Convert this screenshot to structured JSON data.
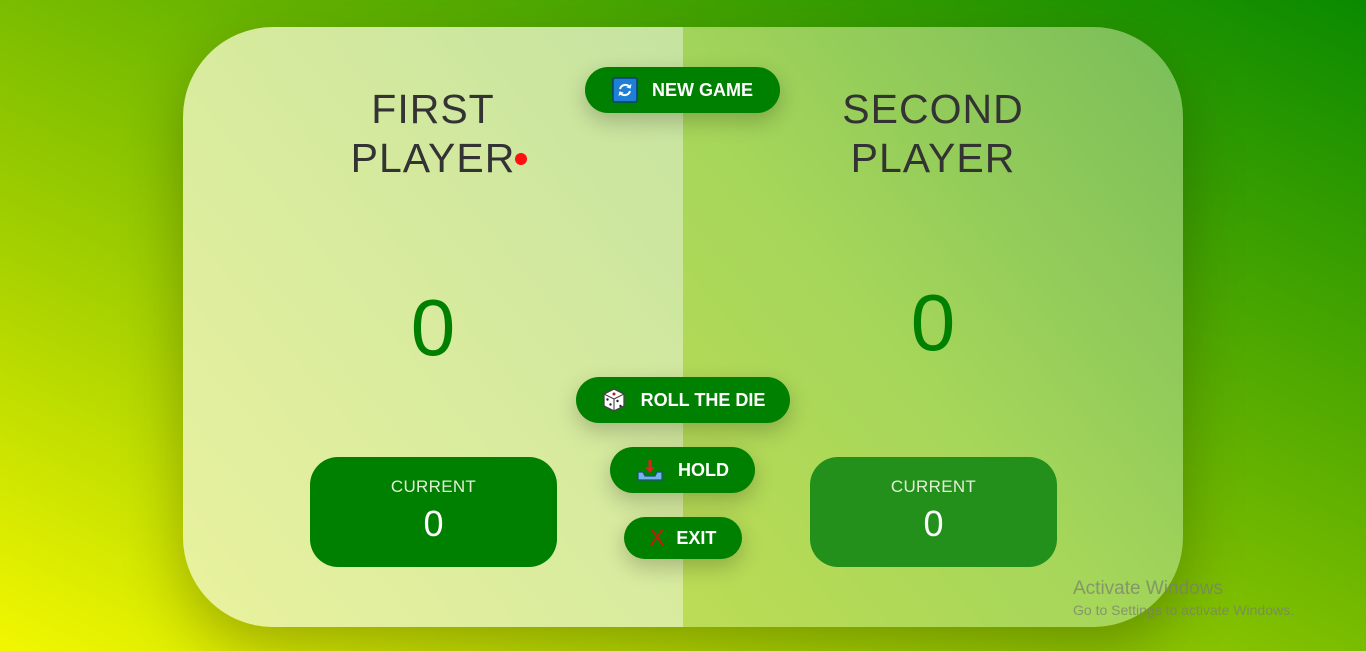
{
  "players": [
    {
      "name_line1": "FIRST",
      "name_line2": "PLAYER",
      "score": "0",
      "current_label": "CURRENT",
      "current_score": "0",
      "active": true
    },
    {
      "name_line1": "SECOND",
      "name_line2": "PLAYER",
      "score": "0",
      "current_label": "CURRENT",
      "current_score": "0",
      "active": false
    }
  ],
  "buttons": {
    "new_game": "NEW GAME",
    "roll": "ROLL THE DIE",
    "hold": "HOLD",
    "exit": "EXIT",
    "exit_icon": "X"
  },
  "icons": {
    "new_game": "refresh-icon",
    "roll": "dice-icon",
    "hold": "inbox-tray-icon",
    "exit": "cross-icon"
  },
  "colors": {
    "button": "#008000",
    "score": "#008000",
    "active_indicator": "#ff0f0f",
    "name_text": "#333333"
  },
  "watermark": {
    "title": "Activate Windows",
    "subtitle": "Go to Settings to activate Windows."
  }
}
